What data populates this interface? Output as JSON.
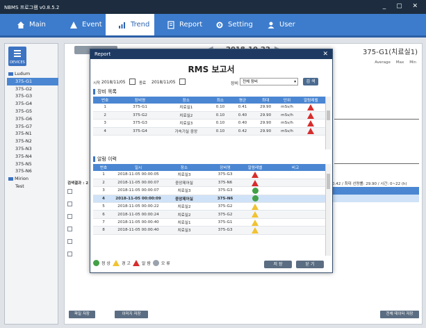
{
  "app": {
    "title": "NBMS 프로그램 v0.8.5.2",
    "window_controls": "_ ▢ ✕"
  },
  "menu": [
    {
      "label": "Main",
      "icon": "home-icon"
    },
    {
      "label": "Event",
      "icon": "warning-icon"
    },
    {
      "label": "Trend",
      "icon": "chart-icon"
    },
    {
      "label": "Report",
      "icon": "document-icon"
    },
    {
      "label": "Setting",
      "icon": "gear-icon"
    },
    {
      "label": "User",
      "icon": "user-icon"
    }
  ],
  "sidebar": {
    "device_button": "DEVICES",
    "groups": [
      {
        "name": "Ludum",
        "items": [
          "375-G1",
          "375-G2",
          "375-G3",
          "375-G4",
          "375-G5",
          "375-G6",
          "375-G7",
          "375-N1",
          "375-N2",
          "375-N3",
          "375-N4",
          "375-N5",
          "375-N6"
        ]
      },
      {
        "name": "Mirion",
        "items": [
          "Test"
        ]
      }
    ]
  },
  "background": {
    "date": "2018-10-22",
    "chart_title": "375-G1(치료실1)",
    "legend": [
      "Average",
      "Max",
      "Min"
    ],
    "status_line": "0.42  /  최대 선량률: 29.90  /  시간: 0~22 (h)",
    "result_label": "검색결과 : 2",
    "save_button": "파일 저장",
    "image_save_button": "이미지 저장",
    "all_save_button": "전체 데이터 저장"
  },
  "dialog": {
    "title": "Report",
    "report_title": "RMS 보고서",
    "start_label": "시작",
    "start_date": "2018/11/05",
    "end_label": "종료",
    "end_date": "2018/11/05",
    "device_label": "장비",
    "device_value": "전체 장비",
    "search_button": "검 색",
    "section1": "장비 목록",
    "section2": "알람 이력",
    "device_table": {
      "headers": [
        "번호",
        "장비명",
        "장소",
        "최소",
        "평균",
        "최대",
        "단위",
        "알람레벨"
      ],
      "rows": [
        [
          "1",
          "375-G1",
          "치료실1",
          "0.10",
          "0.41",
          "29.90",
          "mSv/h",
          "red"
        ],
        [
          "2",
          "375-G2",
          "치료실2",
          "0.10",
          "0.40",
          "29.90",
          "mSv/h",
          "red"
        ],
        [
          "3",
          "375-G3",
          "치료실3",
          "0.10",
          "0.40",
          "29.90",
          "mSv/h",
          "red"
        ],
        [
          "4",
          "375-G4",
          "가속기실 중앙",
          "0.10",
          "0.42",
          "29.90",
          "mSv/h",
          "red"
        ]
      ]
    },
    "alarm_table": {
      "headers": [
        "번호",
        "일시",
        "장소",
        "장비명",
        "알람레벨",
        "비고"
      ],
      "rows": [
        [
          "1",
          "2018-11-05 00:00:05",
          "치료실3",
          "375-G3",
          "red"
        ],
        [
          "2",
          "2018-11-05 00:00:07",
          "중앙제어실",
          "375-N6",
          "red"
        ],
        [
          "3",
          "2018-11-05 00:00:07",
          "치료실3",
          "375-G3",
          "green"
        ],
        [
          "4",
          "2018-11-05 00:00:09",
          "중앙제어실",
          "375-N6",
          "green"
        ],
        [
          "5",
          "2018-11-05 00:00:22",
          "치료실2",
          "375-G2",
          "yellow"
        ],
        [
          "6",
          "2018-11-05 00:00:24",
          "치료실2",
          "375-G2",
          "yellow"
        ],
        [
          "7",
          "2018-11-05 00:00:40",
          "치료실1",
          "375-G1",
          "yellow"
        ],
        [
          "8",
          "2018-11-05 00:00:40",
          "치료실3",
          "375-G3",
          "yellow"
        ]
      ]
    },
    "legend": [
      "정 상",
      "경 고",
      "알 람",
      "오 류"
    ],
    "save_button": "저 장",
    "close_button": "닫 기"
  },
  "colors": {
    "accent": "#3d7ccc",
    "alarm": "#d72d2d",
    "warn": "#f1c232",
    "ok": "#43a047",
    "error": "#9aa3ad"
  }
}
